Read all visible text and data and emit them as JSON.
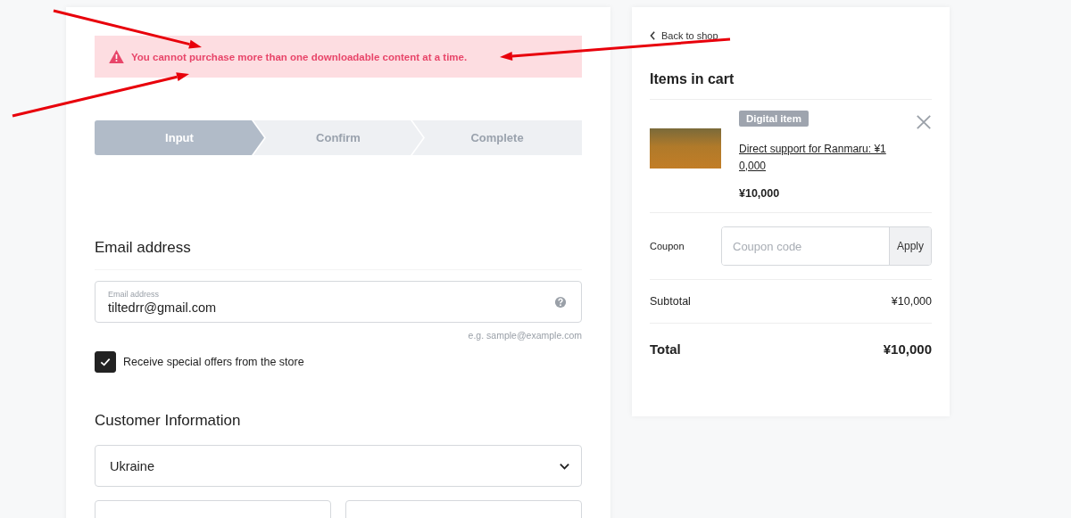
{
  "alert": {
    "message": "You cannot purchase more than one downloadable content at a time."
  },
  "steps": [
    {
      "label": "Input",
      "selected": true
    },
    {
      "label": "Confirm",
      "selected": false
    },
    {
      "label": "Complete",
      "selected": false
    }
  ],
  "email_section": {
    "heading": "Email address",
    "field_label": "Email address",
    "value": "tiltedrr@gmail.com",
    "hint": "e.g. sample@example.com",
    "offers_checkbox": {
      "label": "Receive special offers from the store",
      "checked": true
    }
  },
  "customer_section": {
    "heading": "Customer Information",
    "country": "Ukraine"
  },
  "cart": {
    "back_link": "Back to shop",
    "heading": "Items in cart",
    "items": [
      {
        "badge": "Digital item",
        "name": "Direct support for Ranmaru: ¥1\n0,000",
        "price": "¥10,000"
      }
    ],
    "coupon": {
      "label": "Coupon",
      "placeholder": "Coupon code",
      "button": "Apply"
    },
    "subtotal": {
      "label": "Subtotal",
      "value": "¥10,000"
    },
    "total": {
      "label": "Total",
      "value": "¥10,000"
    }
  }
}
